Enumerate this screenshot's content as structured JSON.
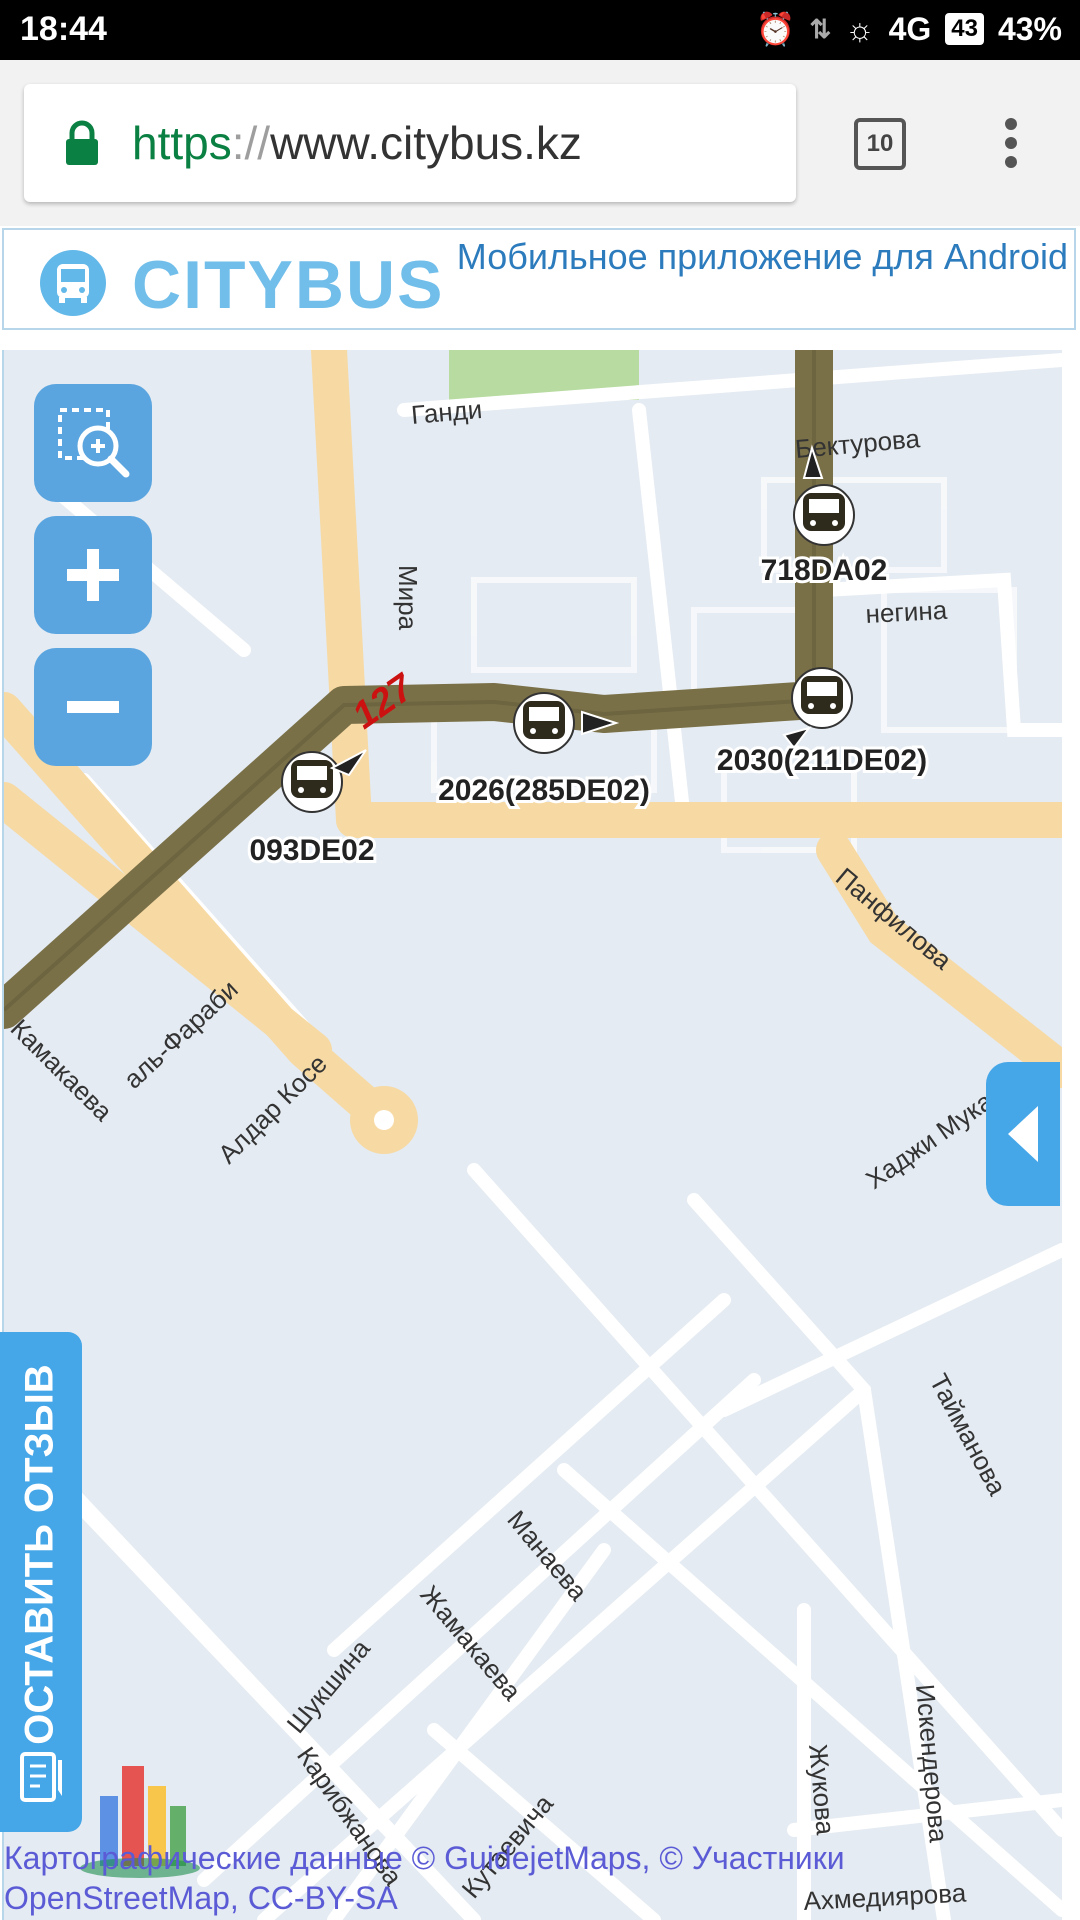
{
  "status_bar": {
    "time": "18:44",
    "network": "4G",
    "battery_badge": "43",
    "battery_percent": "43%"
  },
  "browser": {
    "url_scheme": "https",
    "url_separator": "://",
    "url_host": "www.citybus.kz",
    "tab_count": "10"
  },
  "header": {
    "logo_text": "CITYBUS",
    "app_link": "Мобильное приложение для Android"
  },
  "map": {
    "route_number": "127",
    "streets": [
      "Ганди",
      "Мира",
      "Бектурова",
      "негина",
      "аль-Фараби",
      "Панфилова",
      "Камакаева",
      "Алдар Косе",
      "Хаджи Мукана",
      "Тайманова",
      "Манаева",
      "Жамакаева",
      "Шукшина",
      "Карибжанова",
      "Искендерова",
      "Жукова",
      "Ахмедиярова",
      "Кутаевича"
    ],
    "vehicles": [
      {
        "label": "718DA02"
      },
      {
        "label": "2030(211DE02)"
      },
      {
        "label": "2026(285DE02)"
      },
      {
        "label": "093DE02"
      }
    ],
    "attribution_line1": "Картографические данные © GuidejetMaps, © Участники",
    "attribution_line2": "OpenStreetMap, CC-BY-SA",
    "watermark": "Guidejet"
  },
  "feedback": {
    "label": "ОСТАВИТЬ ОТЗЫВ"
  },
  "colors": {
    "route": "#7a7048",
    "button": "#5aa5df",
    "accent": "#45a6e8",
    "major_road": "#f7d9a3"
  }
}
